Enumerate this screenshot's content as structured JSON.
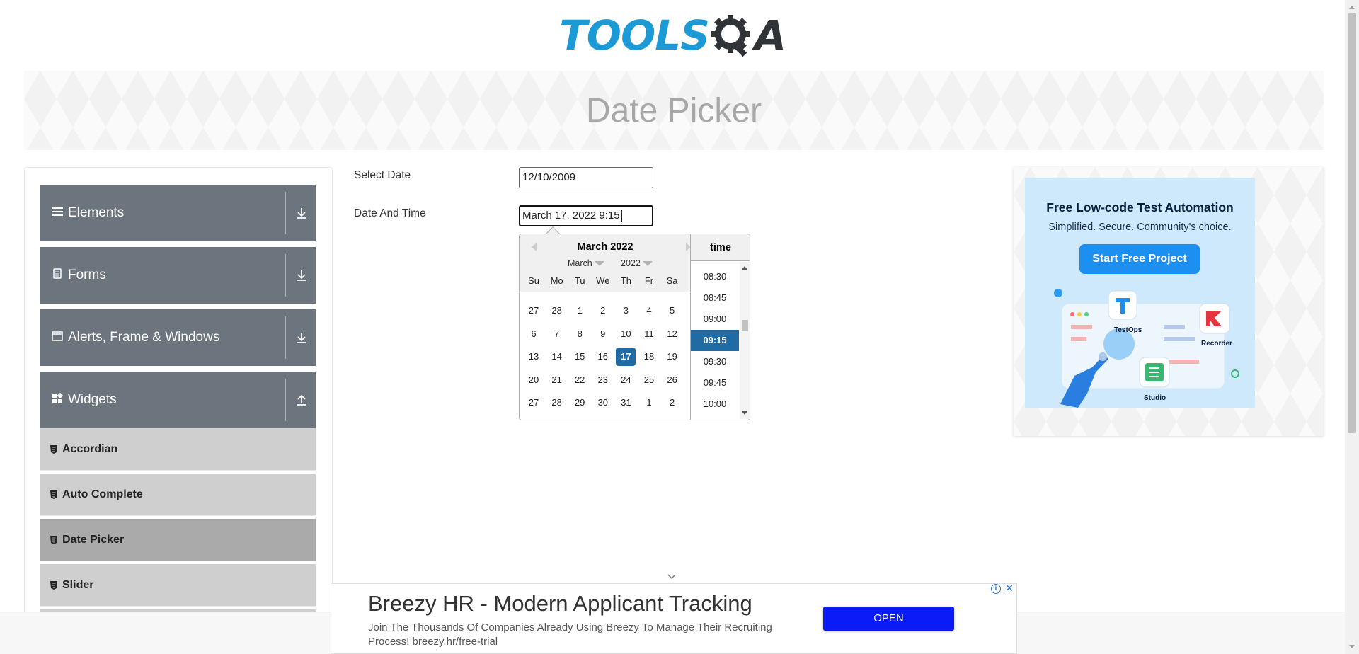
{
  "header": {
    "logo_part1": "TOOLS",
    "logo_part2": "A",
    "page_title": "Date Picker"
  },
  "sidebar": {
    "groups": [
      {
        "label": "Elements",
        "icon": "hamburger-icon",
        "arrow": "download-arrow-icon"
      },
      {
        "label": "Forms",
        "icon": "document-icon",
        "arrow": "download-arrow-icon"
      },
      {
        "label": "Alerts, Frame & Windows",
        "icon": "window-icon",
        "arrow": "download-arrow-icon"
      },
      {
        "label": "Widgets",
        "icon": "widgets-icon",
        "arrow": "upload-arrow-icon"
      }
    ],
    "items": [
      {
        "label": "Accordian"
      },
      {
        "label": "Auto Complete"
      },
      {
        "label": "Date Picker",
        "active": true
      },
      {
        "label": "Slider"
      }
    ]
  },
  "form": {
    "select_date_label": "Select Date",
    "select_date_value": "12/10/2009",
    "date_time_label": "Date And Time",
    "date_time_value": "March 17, 2022 9:15"
  },
  "calendar": {
    "title": "March 2022",
    "month_select": "March",
    "year_select": "2022",
    "weekdays": [
      "Su",
      "Mo",
      "Tu",
      "We",
      "Th",
      "Fr",
      "Sa"
    ],
    "weeks": [
      [
        "27",
        "28",
        "1",
        "2",
        "3",
        "4",
        "5"
      ],
      [
        "6",
        "7",
        "8",
        "9",
        "10",
        "11",
        "12"
      ],
      [
        "13",
        "14",
        "15",
        "16",
        "17",
        "18",
        "19"
      ],
      [
        "20",
        "21",
        "22",
        "23",
        "24",
        "25",
        "26"
      ],
      [
        "27",
        "28",
        "29",
        "30",
        "31",
        "1",
        "2"
      ]
    ],
    "selected_day": "17",
    "time_header": "time",
    "times": [
      "08:30",
      "08:45",
      "09:00",
      "09:15",
      "09:30",
      "09:45",
      "10:00"
    ],
    "selected_time": "09:15",
    "accent": "#216ba5"
  },
  "ad_right": {
    "title": "Free Low-code Test Automation",
    "subtitle": "Simplified. Secure. Community's choice.",
    "button": "Start Free Project",
    "labels": [
      "TestOps",
      "Recorder",
      "Studio"
    ]
  },
  "ad_bottom": {
    "title": "Breezy HR - Modern Applicant Tracking",
    "text": "Join The Thousands Of Companies Already Using Breezy To Manage Their Recruiting Process! breezy.hr/free-trial",
    "button": "OPEN"
  }
}
